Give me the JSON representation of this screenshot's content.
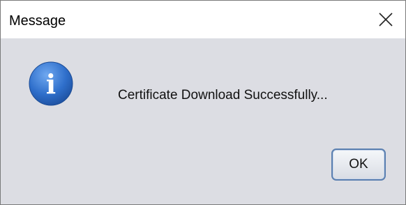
{
  "window": {
    "title": "Message",
    "close_icon": "close-icon"
  },
  "dialog": {
    "icon": "info-icon",
    "icon_glyph": "i",
    "message": "Certificate Download Successfully...",
    "ok_label": "OK"
  },
  "colors": {
    "titlebar_bg": "#ffffff",
    "content_bg": "#dcdde3",
    "icon_blue": "#2f6fcb",
    "button_border": "#5a7fb0"
  }
}
